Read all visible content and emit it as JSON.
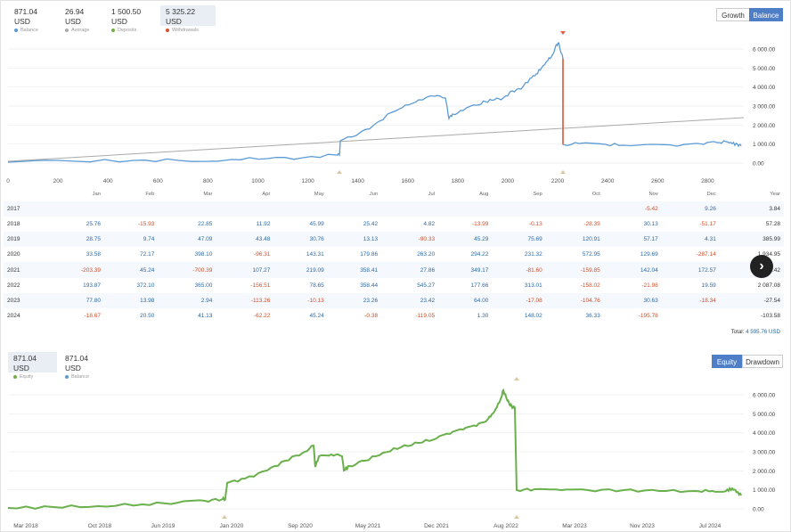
{
  "top_stats": [
    {
      "value": "871.04 USD",
      "label": "Balance",
      "color": "#5b9bd5"
    },
    {
      "value": "26.94 USD",
      "label": "Average",
      "color": "#aaaaaa"
    },
    {
      "value": "1 500.50 USD",
      "label": "Deposits",
      "color": "#70ad47"
    },
    {
      "value": "5 325.22 USD",
      "label": "Withdrawals",
      "color": "#d9502a"
    }
  ],
  "toggle_top": {
    "growth": "Growth",
    "balance": "Balance"
  },
  "balance_chart": {
    "x_ticks": [
      "0",
      "200",
      "400",
      "600",
      "800",
      "1000",
      "1200",
      "1400",
      "1600",
      "1800",
      "2000",
      "2200",
      "2400",
      "2600",
      "2800"
    ],
    "y_ticks": [
      "6 000.00",
      "5 000.00",
      "4 000.00",
      "3 000.00",
      "2 000.00",
      "1 000.00",
      "0.00"
    ],
    "colors": {
      "balance": "#5b9bd5",
      "average": "#aaaaaa",
      "withdrawal": "#e06040"
    }
  },
  "months": [
    "Jan",
    "Feb",
    "Mar",
    "Apr",
    "May",
    "Jun",
    "Jul",
    "Aug",
    "Sep",
    "Oct",
    "Nov",
    "Dec",
    "Year"
  ],
  "rows": [
    {
      "year": "2017",
      "vals": [
        "",
        "",
        "",
        "",
        "",
        "",
        "",
        "",
        "",
        "",
        "-5.42",
        "9.26",
        "3.84"
      ]
    },
    {
      "year": "2018",
      "vals": [
        "25.76",
        "-15.93",
        "22.85",
        "11.92",
        "45.99",
        "25.42",
        "4.82",
        "-13.99",
        "-0.13",
        "-28.39",
        "30.13",
        "-51.17",
        "57.28"
      ]
    },
    {
      "year": "2019",
      "vals": [
        "28.75",
        "9.74",
        "47.09",
        "43.48",
        "30.76",
        "13.13",
        "-90.33",
        "45.29",
        "75.69",
        "120.91",
        "57.17",
        "4.31",
        "385.99"
      ]
    },
    {
      "year": "2020",
      "vals": [
        "33.58",
        "72.17",
        "398.10",
        "-96.31",
        "143.31",
        "179.86",
        "263.20",
        "294.22",
        "231.32",
        "572.95",
        "129.69",
        "-287.14",
        "1 934.95"
      ]
    },
    {
      "year": "2021",
      "vals": [
        "-203.39",
        "45.24",
        "-700.39",
        "107.27",
        "219.09",
        "358.41",
        "27.86",
        "349.17",
        "-81.60",
        "-159.85",
        "142.04",
        "172.57",
        "..42"
      ]
    },
    {
      "year": "2022",
      "vals": [
        "193.87",
        "372.10",
        "365.00",
        "-156.51",
        "78.65",
        "358.44",
        "545.27",
        "177.66",
        "313.01",
        "-158.02",
        "-21.98",
        "19.59",
        "2 087.08"
      ]
    },
    {
      "year": "2023",
      "vals": [
        "77.80",
        "13.98",
        "2.94",
        "-113.26",
        "-10.13",
        "23.26",
        "23.42",
        "64.00",
        "-17.08",
        "-104.76",
        "30.63",
        "-18.34",
        "-27.54"
      ]
    },
    {
      "year": "2024",
      "vals": [
        "-18.67",
        "20.50",
        "41.13",
        "-62.22",
        "45.24",
        "-0.38",
        "-119.05",
        "1.30",
        "148.02",
        "36.33",
        "-195.78",
        "",
        "-103.58"
      ]
    }
  ],
  "total": {
    "label": "Total:",
    "value": "4 595.76 USD"
  },
  "equity_stats": [
    {
      "value": "871.04 USD",
      "label": "Equity",
      "color": "#70ad47"
    },
    {
      "value": "871.04 USD",
      "label": "Balance",
      "color": "#5b9bd5"
    }
  ],
  "toggle_bottom": {
    "equity": "Equity",
    "drawdown": "Drawdown"
  },
  "equity_chart": {
    "x_ticks": [
      "Mar 2018",
      "Oct 2018",
      "Jun 2019",
      "Jan 2020",
      "Sep 2020",
      "May 2021",
      "Dec 2021",
      "Aug 2022",
      "Mar 2023",
      "Nov 2023",
      "Jul 2024"
    ],
    "y_ticks": [
      "6 000.00",
      "5 000.00",
      "4 000.00",
      "3 000.00",
      "2 000.00",
      "1 000.00",
      "0.00"
    ],
    "colors": {
      "equity": "#6ab04c"
    }
  },
  "nav_icon": "chevron-right-icon"
}
